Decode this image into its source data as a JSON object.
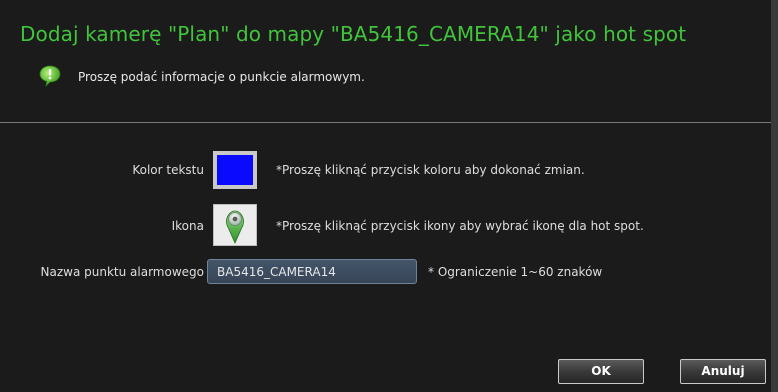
{
  "dialog": {
    "title": "Dodaj kamerę \"Plan\" do mapy \"BA5416_CAMERA14\" jako hot spot",
    "info_text": "Proszę podać informacje o punkcie alarmowym.",
    "info_icon": "info-bubble-icon"
  },
  "form": {
    "text_color_label": "Kolor tekstu",
    "text_color_value": "#0a0aff",
    "text_color_hint": "*Proszę kliknąć przycisk koloru aby dokonać zmian.",
    "icon_label": "Ikona",
    "icon_name": "map-pin-icon",
    "icon_hint": "*Proszę kliknąć przycisk ikony aby wybrać ikonę dla hot spot.",
    "alarm_name_label": "Nazwa punktu alarmowego",
    "alarm_name_value": "BA5416_CAMERA14",
    "alarm_name_hint": "* Ograniczenie 1~60 znaków"
  },
  "buttons": {
    "ok_label": "OK",
    "cancel_label": "Anuluj"
  },
  "colors": {
    "title": "#41c43b",
    "background": "#1b1b1b"
  }
}
